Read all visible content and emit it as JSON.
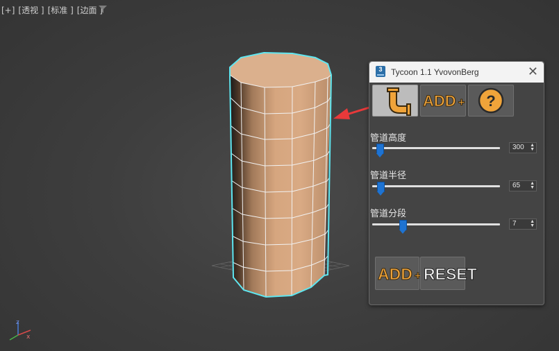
{
  "viewport": {
    "labels": [
      "[+]",
      "[透视 ]",
      "[标准 ]",
      "[边面 ]"
    ]
  },
  "panel": {
    "title": "Tycoon 1.1 YvovonBerg",
    "close_glyph": "✕",
    "app_icon_text": "3",
    "toolbar": {
      "pipe_button_icon": "pipe-icon",
      "add_label": "ADD",
      "add_plus": "+",
      "help_glyph": "?"
    },
    "params": [
      {
        "label": "管道高度",
        "value": "300",
        "level": 0.06
      },
      {
        "label": "管道半径",
        "value": "65",
        "level": 0.07
      },
      {
        "label": "管道分段",
        "value": "7",
        "level": 0.24
      }
    ],
    "bottom": {
      "add_label": "ADD",
      "add_plus": "+",
      "reset_label": "RESET"
    }
  },
  "axis": {
    "z": "z",
    "x": "x"
  },
  "colors": {
    "cylinder": "#d9a880",
    "selection": "#5fe6f0",
    "arrow": "#e8393a",
    "accent": "#f0a43a",
    "slider": "#1e73d2"
  }
}
